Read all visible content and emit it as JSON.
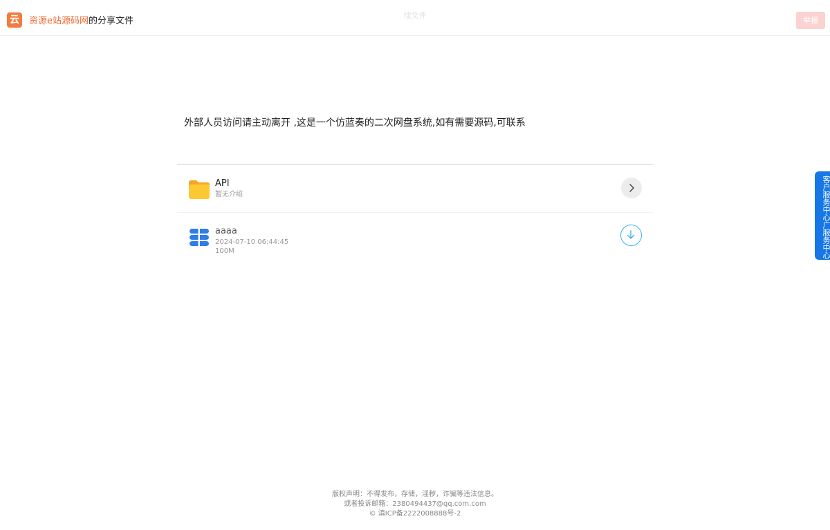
{
  "header": {
    "logo_char": "云",
    "site_name": "资源e站源码网",
    "share_label": "的分享文件",
    "center_title": "搜文件",
    "report_label": "举报"
  },
  "notice": "外部人员访问请主动离开 ,这是一个仿蓝奏的二次网盘系统,如有需要源码,可联系",
  "files": [
    {
      "type": "folder",
      "name": "API",
      "description": "暂无介绍",
      "icon": "folder-icon",
      "action_icon": "chevron-right-icon"
    },
    {
      "type": "file",
      "name": "aaaa",
      "date": "2024-07-10 06:44:45",
      "size": "100M",
      "icon": "file-stack-icon",
      "action_icon": "download-icon"
    }
  ],
  "service_tab": "客户服务中心广服务中心",
  "footer": {
    "line1": "版权声明：不得发布，存储，淫秽，诈骗等违法信息。",
    "line2": "或者投诉邮箱：2380494437@qq.com.com",
    "line3": "© 滇ICP备2222008888号-2"
  },
  "colors": {
    "brand": "#f06a35",
    "report_bg": "#fad3d0",
    "service_blue": "#1677e6",
    "download_ring": "#3db2ea",
    "folder_yellow": "#fcc933"
  }
}
